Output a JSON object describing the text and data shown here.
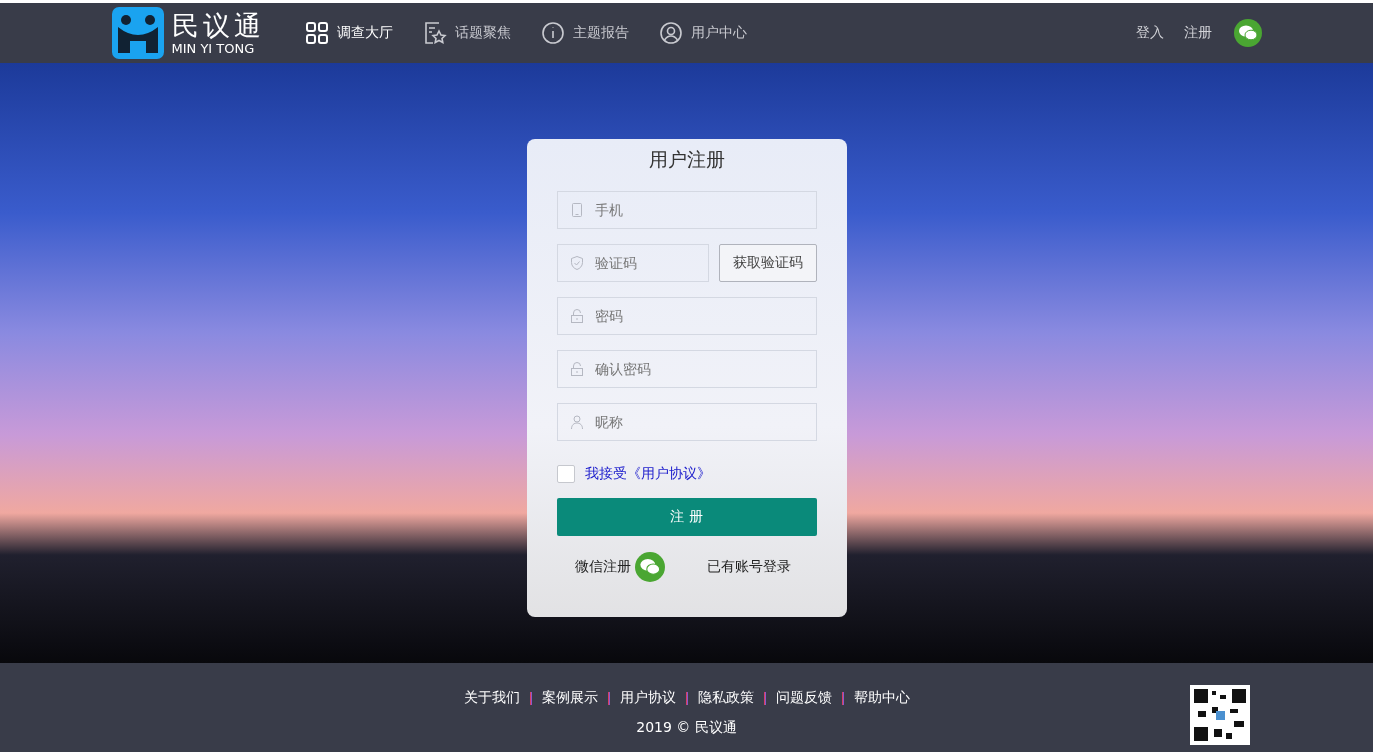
{
  "header": {
    "logo": {
      "name": "民议通",
      "subtitle": "MIN YI TONG"
    },
    "nav": [
      {
        "label": "调查大厅",
        "selected": true
      },
      {
        "label": "话题聚焦",
        "selected": false
      },
      {
        "label": "主题报告",
        "selected": false
      },
      {
        "label": "用户中心",
        "selected": false
      }
    ],
    "auth": [
      "登入",
      "注册"
    ]
  },
  "form": {
    "title": "用户注册",
    "fields": [
      {
        "placeholder": "手机"
      },
      {
        "placeholder": "验证码",
        "button": "获取验证码"
      },
      {
        "placeholder": "密码"
      },
      {
        "placeholder": "确认密码"
      },
      {
        "placeholder": "昵称"
      }
    ],
    "agree": {
      "label": "我接受《用户协议》",
      "checked": false
    },
    "submit": "注 册",
    "wechat_register": "微信注册",
    "login_link": "已有账号登录"
  },
  "footer": {
    "links": [
      "关于我们",
      "案例展示",
      "用户协议",
      "隐私政策",
      "问题反馈",
      "帮助中心"
    ],
    "copyright": "2019 © 民议通"
  }
}
